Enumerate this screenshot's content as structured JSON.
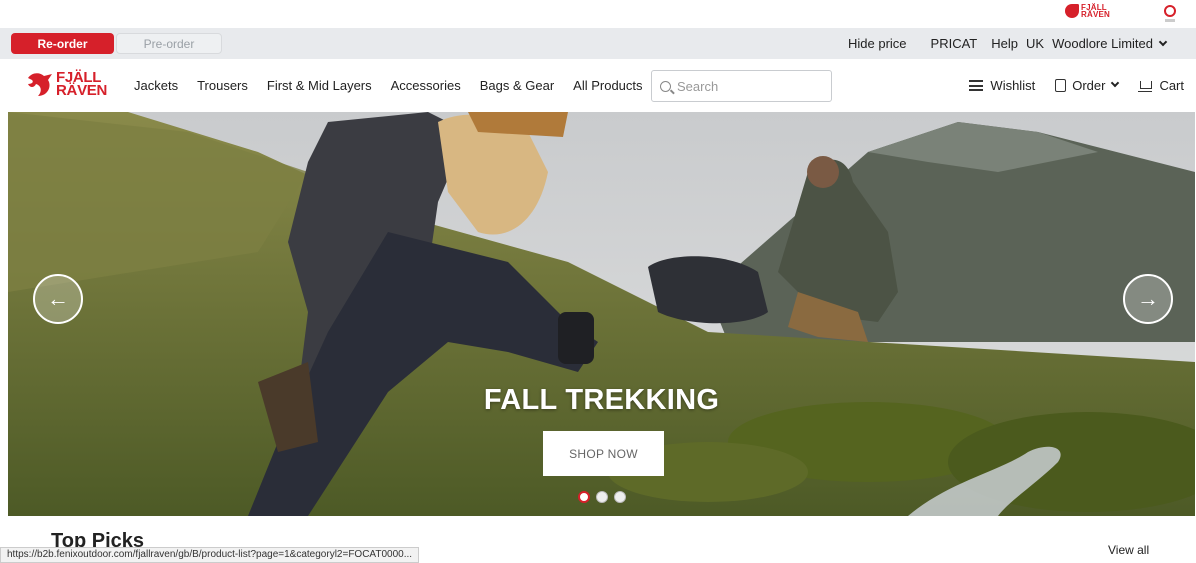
{
  "utility_bar": {
    "reorder_label": "Re-order",
    "preorder_label": "Pre-order",
    "hide_price": "Hide price",
    "pricat": "PRICAT",
    "help": "Help",
    "region": "UK",
    "account": "Woodlore Limited"
  },
  "brand": {
    "logo_line1": "FJÄLL",
    "logo_line2": "RÄVEN",
    "color": "#d6202a"
  },
  "nav": {
    "links": [
      "Jackets",
      "Trousers",
      "First & Mid Layers",
      "Accessories",
      "Bags & Gear",
      "All Products"
    ],
    "search_placeholder": "Search",
    "wishlist": "Wishlist",
    "order": "Order",
    "cart": "Cart"
  },
  "hero": {
    "title": "FALL TREKKING",
    "cta": "SHOP NOW",
    "slide_count": 3,
    "active_slide": 1,
    "prev_icon": "arrow-left-icon",
    "next_icon": "arrow-right-icon"
  },
  "section": {
    "title": "Top Picks",
    "view_all": "View all"
  },
  "status_bar": {
    "url": "https://b2b.fenixoutdoor.com/fjallraven/gb/B/product-list?page=1&categoryl2=FOCAT0000..."
  }
}
